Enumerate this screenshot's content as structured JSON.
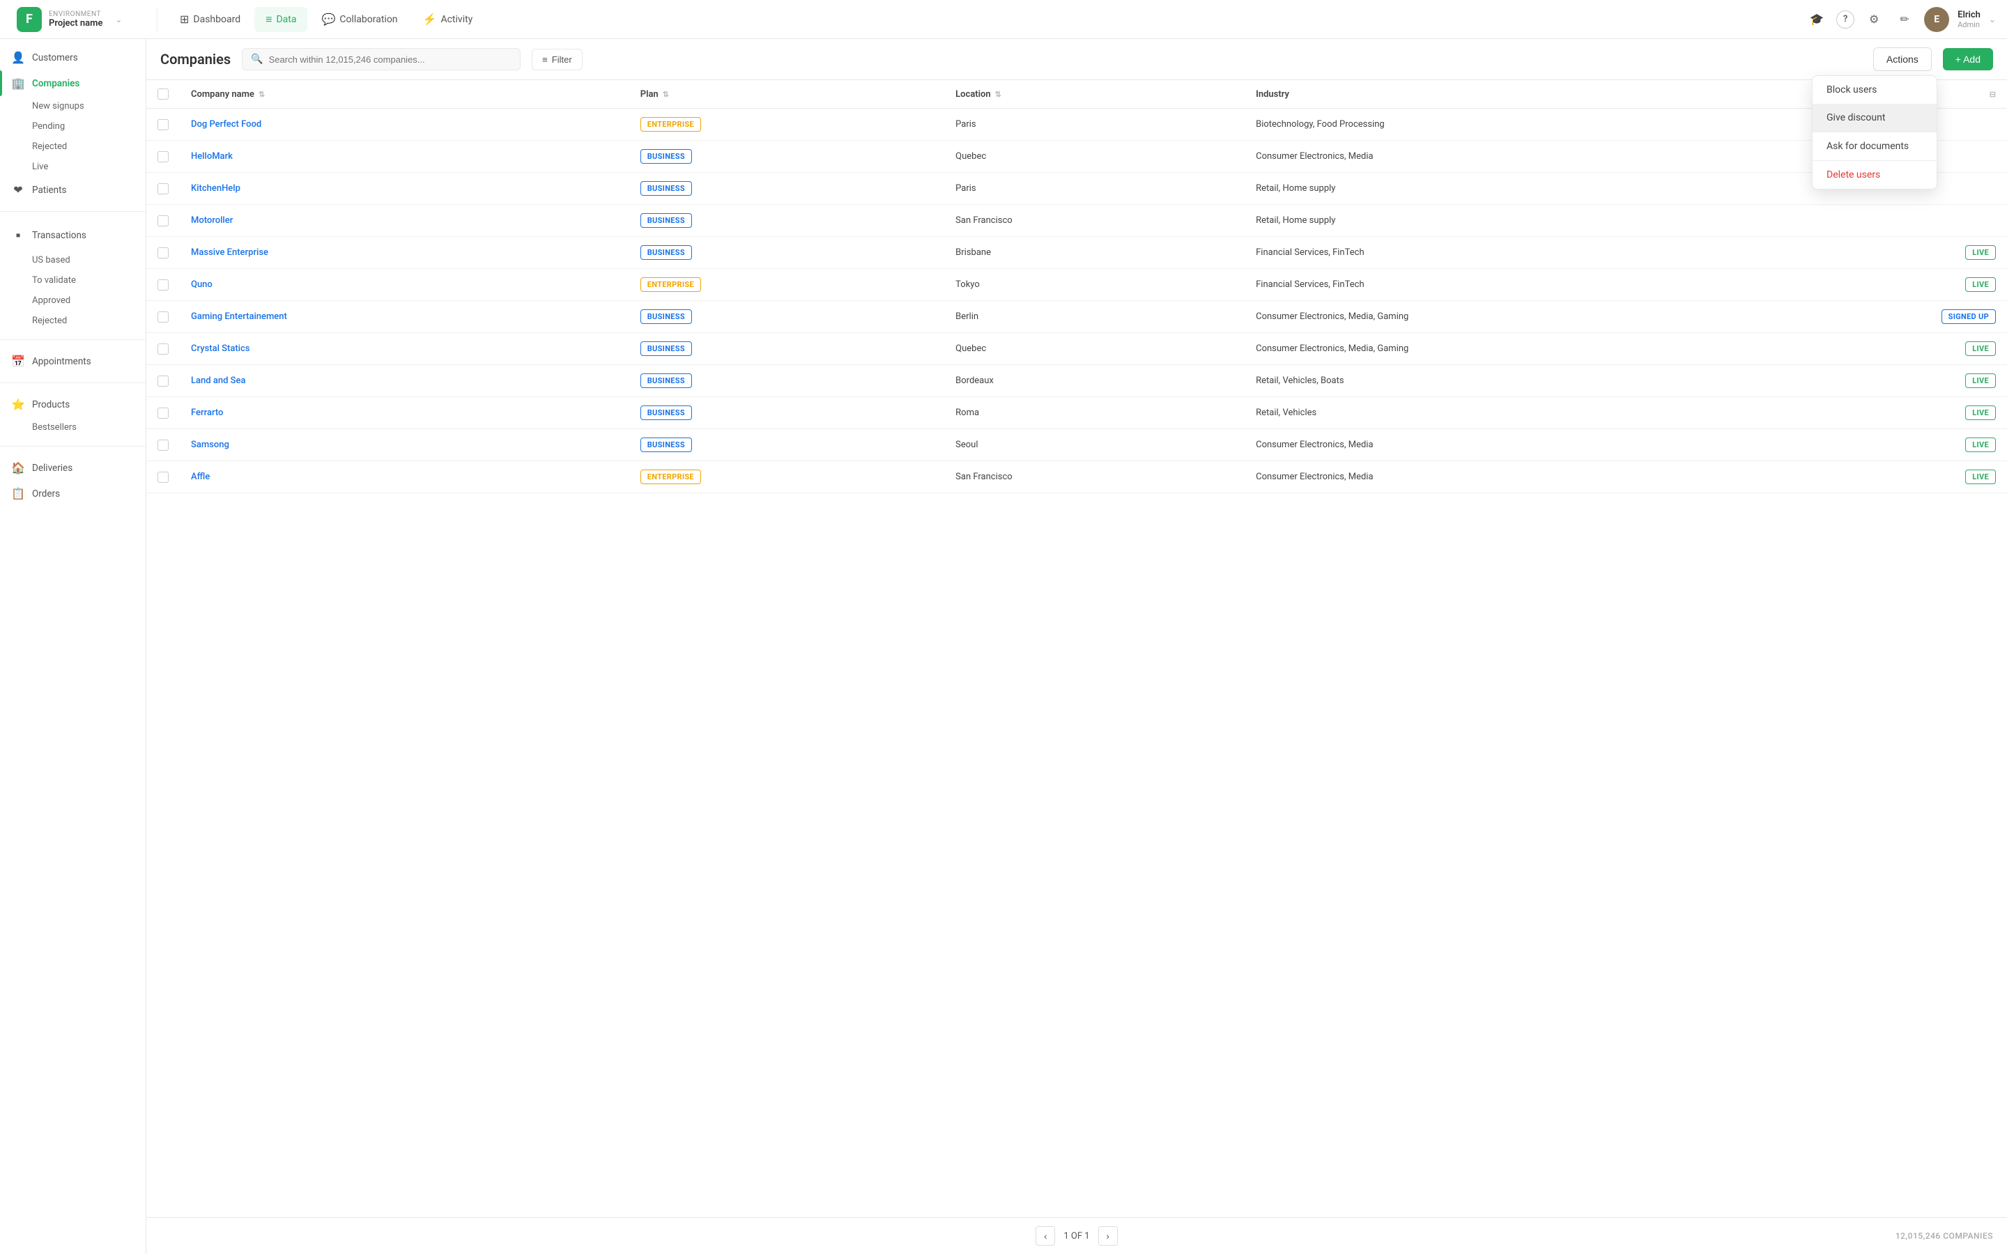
{
  "brand": {
    "logo": "F",
    "env_label": "ENVIRONMENT",
    "project": "Project name",
    "chevron": "⌄"
  },
  "nav": {
    "links": [
      {
        "id": "dashboard",
        "label": "Dashboard",
        "icon": "⊞",
        "active": false
      },
      {
        "id": "data",
        "label": "Data",
        "icon": "≡",
        "active": true
      },
      {
        "id": "collaboration",
        "label": "Collaboration",
        "icon": "💬",
        "active": false
      },
      {
        "id": "activity",
        "label": "Activity",
        "icon": "⚡",
        "active": false
      }
    ],
    "icons": [
      {
        "id": "graduation",
        "symbol": "🎓"
      },
      {
        "id": "help",
        "symbol": "?"
      },
      {
        "id": "settings",
        "symbol": "⚙"
      },
      {
        "id": "edit",
        "symbol": "✏"
      }
    ],
    "user": {
      "name": "Elrich",
      "role": "Admin"
    }
  },
  "sidebar": {
    "sections": [
      {
        "items": [
          {
            "id": "customers",
            "icon": "👤",
            "label": "Customers",
            "active": false,
            "sub": []
          },
          {
            "id": "companies",
            "icon": "🏢",
            "label": "Companies",
            "active": true,
            "sub": [
              "New signups",
              "Pending",
              "Rejected",
              "Live"
            ]
          },
          {
            "id": "patients",
            "icon": "❤",
            "label": "Patients",
            "active": false,
            "sub": []
          }
        ]
      },
      {
        "items": [
          {
            "id": "transactions",
            "icon": "▪",
            "label": "Transactions",
            "active": false,
            "sub": [
              "US based",
              "To validate",
              "Approved",
              "Rejected"
            ]
          }
        ]
      },
      {
        "items": [
          {
            "id": "appointments",
            "icon": "📅",
            "label": "Appointments",
            "active": false,
            "sub": []
          }
        ]
      },
      {
        "items": [
          {
            "id": "products",
            "icon": "⭐",
            "label": "Products",
            "active": false,
            "sub": [
              "Bestsellers"
            ]
          }
        ]
      },
      {
        "items": [
          {
            "id": "deliveries",
            "icon": "🏠",
            "label": "Deliveries",
            "active": false,
            "sub": []
          },
          {
            "id": "orders",
            "icon": "📋",
            "label": "Orders",
            "active": false,
            "sub": []
          }
        ]
      }
    ]
  },
  "page": {
    "title": "Companies",
    "search_placeholder": "Search within 12,015,246 companies...",
    "filter_label": "Filter",
    "actions_label": "Actions",
    "add_label": "+ Add",
    "total_label": "12,015,246 COMPANIES",
    "pagination": {
      "current": "1 OF 1",
      "prev": "‹",
      "next": "›"
    }
  },
  "table": {
    "columns": [
      {
        "id": "company_name",
        "label": "Company name"
      },
      {
        "id": "plan",
        "label": "Plan"
      },
      {
        "id": "location",
        "label": "Location"
      },
      {
        "id": "industry",
        "label": "Industry"
      }
    ],
    "rows": [
      {
        "id": 1,
        "name": "Dog Perfect Food",
        "plan": "ENTERPRISE",
        "plan_type": "enterprise",
        "location": "Paris",
        "industry": "Biotechnology, Food Processing",
        "status": "",
        "status_type": ""
      },
      {
        "id": 2,
        "name": "HelloMark",
        "plan": "BUSINESS",
        "plan_type": "business",
        "location": "Quebec",
        "industry": "Consumer Electronics, Media",
        "status": "",
        "status_type": ""
      },
      {
        "id": 3,
        "name": "KitchenHelp",
        "plan": "BUSINESS",
        "plan_type": "business",
        "location": "Paris",
        "industry": "Retail, Home supply",
        "status": "",
        "status_type": ""
      },
      {
        "id": 4,
        "name": "Motoroller",
        "plan": "BUSINESS",
        "plan_type": "business",
        "location": "San Francisco",
        "industry": "Retail, Home supply",
        "status": "",
        "status_type": ""
      },
      {
        "id": 5,
        "name": "Massive Enterprise",
        "plan": "BUSINESS",
        "plan_type": "business",
        "location": "Brisbane",
        "industry": "Financial Services, FinTech",
        "status": "LIVE",
        "status_type": "live"
      },
      {
        "id": 6,
        "name": "Quno",
        "plan": "ENTERPRISE",
        "plan_type": "enterprise",
        "location": "Tokyo",
        "industry": "Financial Services, FinTech",
        "status": "LIVE",
        "status_type": "live"
      },
      {
        "id": 7,
        "name": "Gaming Entertainement",
        "plan": "BUSINESS",
        "plan_type": "business",
        "location": "Berlin",
        "industry": "Consumer Electronics, Media, Gaming",
        "status": "SIGNED UP",
        "status_type": "signed-up"
      },
      {
        "id": 8,
        "name": "Crystal Statics",
        "plan": "BUSINESS",
        "plan_type": "business",
        "location": "Quebec",
        "industry": "Consumer Electronics, Media, Gaming",
        "status": "LIVE",
        "status_type": "live"
      },
      {
        "id": 9,
        "name": "Land and Sea",
        "plan": "BUSINESS",
        "plan_type": "business",
        "location": "Bordeaux",
        "industry": "Retail, Vehicles, Boats",
        "status": "LIVE",
        "status_type": "live"
      },
      {
        "id": 10,
        "name": "Ferrarto",
        "plan": "BUSINESS",
        "plan_type": "business",
        "location": "Roma",
        "industry": "Retail, Vehicles",
        "status": "LIVE",
        "status_type": "live"
      },
      {
        "id": 11,
        "name": "Samsong",
        "plan": "BUSINESS",
        "plan_type": "business",
        "location": "Seoul",
        "industry": "Consumer Electronics, Media",
        "status": "LIVE",
        "status_type": "live"
      },
      {
        "id": 12,
        "name": "Affle",
        "plan": "ENTERPRISE",
        "plan_type": "enterprise",
        "location": "San Francisco",
        "industry": "Consumer Electronics, Media",
        "status": "LIVE",
        "status_type": "live"
      }
    ]
  },
  "dropdown": {
    "items": [
      {
        "id": "block-users",
        "label": "Block users",
        "type": "normal"
      },
      {
        "id": "give-discount",
        "label": "Give discount",
        "type": "normal"
      },
      {
        "id": "ask-documents",
        "label": "Ask for documents",
        "type": "normal"
      },
      {
        "id": "delete-users",
        "label": "Delete users",
        "type": "danger"
      }
    ]
  },
  "colors": {
    "brand": "#27ae60",
    "primary_text": "#333",
    "link": "#1a73e8",
    "danger": "#e53935",
    "enterprise_badge": "#f0a500",
    "business_badge": "#1a73e8",
    "live_badge": "#27ae60"
  }
}
